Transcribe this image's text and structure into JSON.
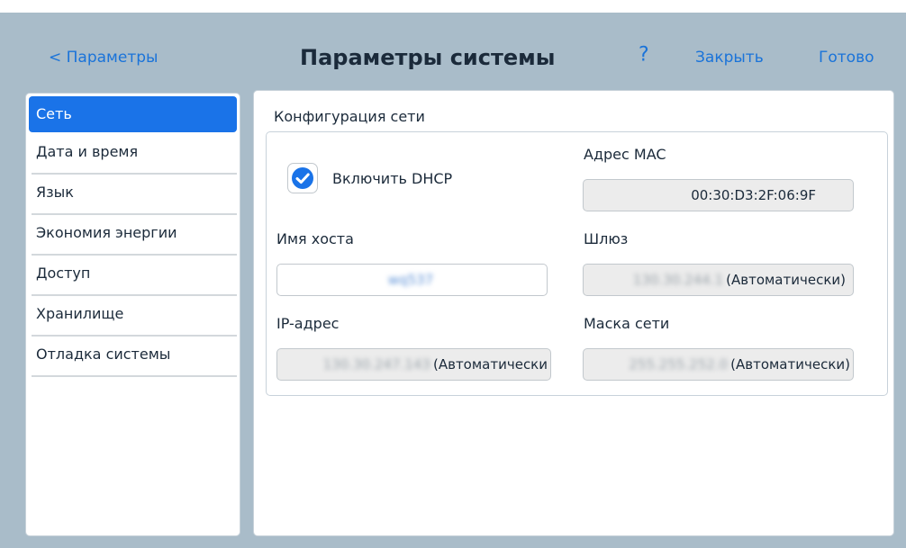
{
  "header": {
    "back_label": "< Параметры",
    "title": "Параметры системы",
    "help_label": "?",
    "close_label": "Закрыть",
    "done_label": "Готово"
  },
  "sidebar": {
    "items": [
      {
        "label": "Сеть",
        "active": true
      },
      {
        "label": "Дата и время",
        "active": false
      },
      {
        "label": "Язык",
        "active": false
      },
      {
        "label": "Экономия энергии",
        "active": false
      },
      {
        "label": "Доступ",
        "active": false
      },
      {
        "label": "Хранилище",
        "active": false
      },
      {
        "label": "Отладка системы",
        "active": false
      }
    ]
  },
  "network": {
    "section_title": "Конфигурация сети",
    "dhcp": {
      "label": "Включить DHCP",
      "checked": true
    },
    "mac": {
      "label": "Адрес MAC",
      "value": "00:30:D3:2F:06:9F"
    },
    "hostname": {
      "label": "Имя хоста",
      "value": "wq537"
    },
    "gateway": {
      "label": "Шлюз",
      "value": "130.30.244.1",
      "suffix": "(Автоматически)"
    },
    "ip": {
      "label": "IP-адрес",
      "value": "130.30.247.143",
      "suffix": "(Автоматически"
    },
    "netmask": {
      "label": "Маска сети",
      "value": "255.255.252.0",
      "suffix": "(Автоматически)"
    }
  },
  "colors": {
    "accent": "#1a73e8",
    "background": "#a9bcc9",
    "text": "#1b2a3a"
  },
  "icons": {
    "checkmark": "checkmark-icon"
  }
}
